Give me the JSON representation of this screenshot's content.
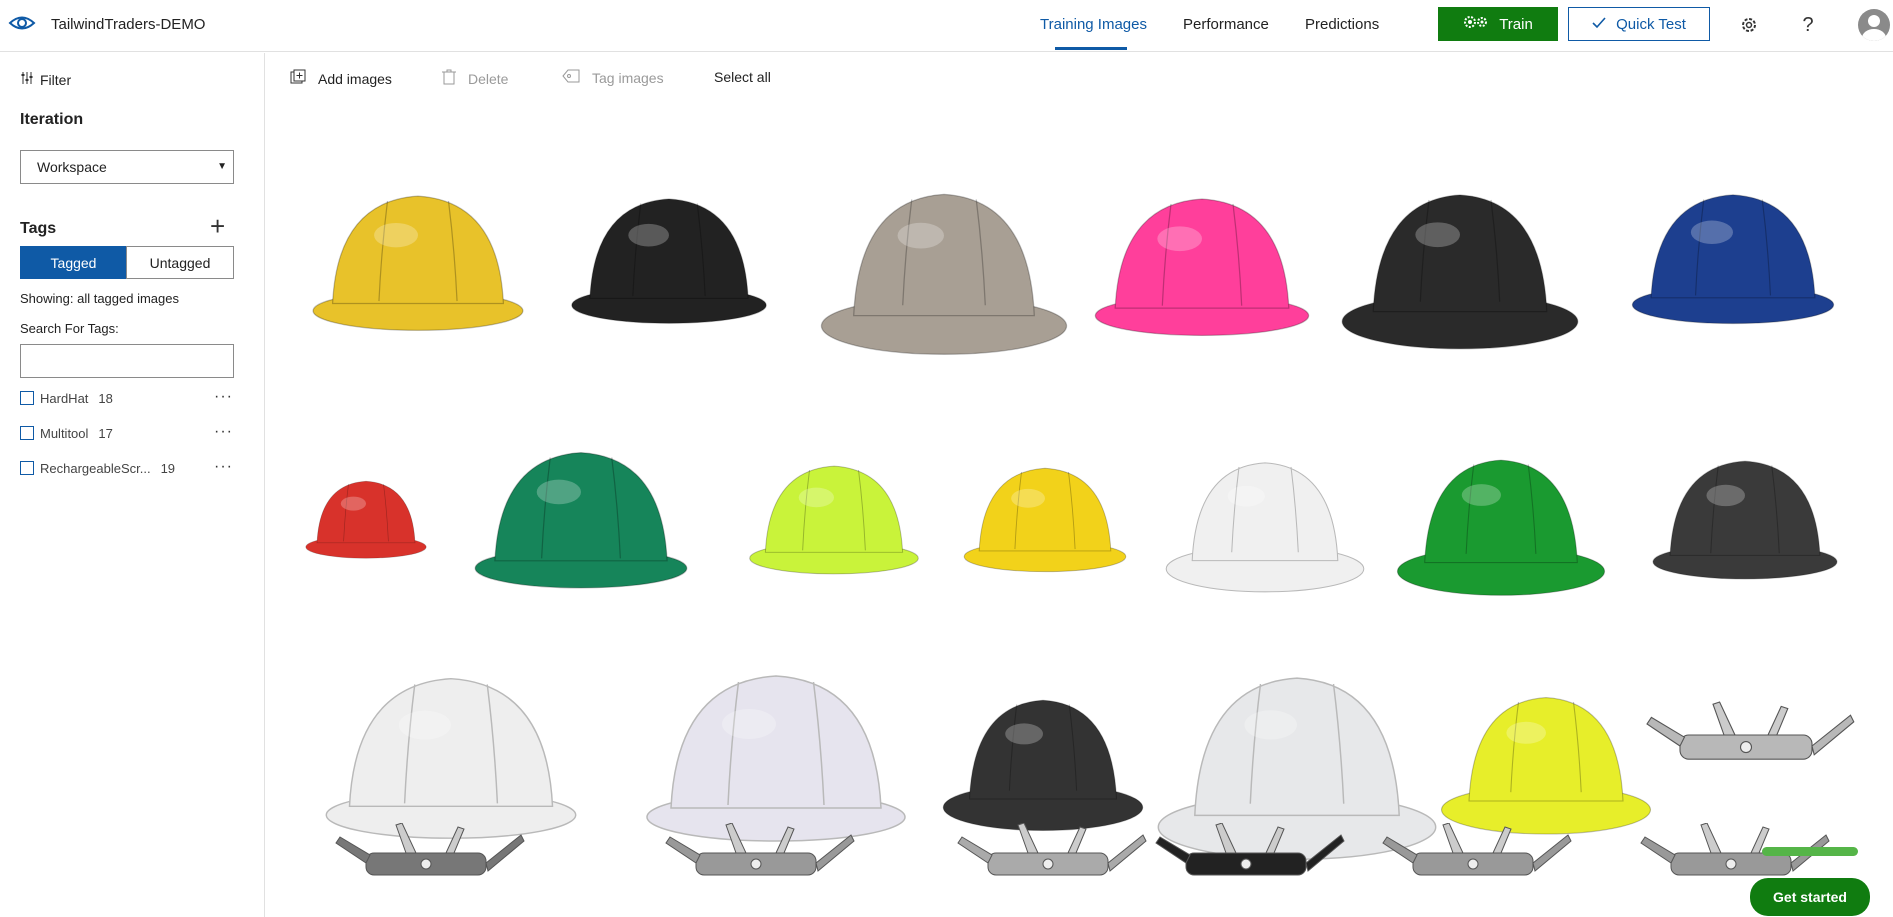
{
  "app": {
    "title": "TailwindTraders-DEMO"
  },
  "nav": {
    "tabs": [
      {
        "label": "Training Images",
        "active": true
      },
      {
        "label": "Performance",
        "active": false
      },
      {
        "label": "Predictions",
        "active": false
      }
    ],
    "train_label": "Train",
    "quick_test_label": "Quick Test"
  },
  "sidebar": {
    "filter_label": "Filter",
    "iteration_label": "Iteration",
    "iteration_value": "Workspace",
    "tags_label": "Tags",
    "tagged_label": "Tagged",
    "untagged_label": "Untagged",
    "showing_text": "Showing: all tagged images",
    "search_label": "Search For Tags:",
    "search_value": "",
    "tags": [
      {
        "name": "HardHat",
        "count": "18"
      },
      {
        "name": "Multitool",
        "count": "17"
      },
      {
        "name": "RechargeableScr...",
        "count": "19"
      }
    ]
  },
  "toolbar": {
    "add_images": "Add images",
    "delete": "Delete",
    "tag_images": "Tag images",
    "select_all": "Select all"
  },
  "gallery": {
    "images": [
      {
        "subject": "hardhat",
        "color": "#e8c22a"
      },
      {
        "subject": "hardhat",
        "color": "#222222"
      },
      {
        "subject": "hardhat",
        "color": "#a89f94"
      },
      {
        "subject": "hardhat",
        "color": "#ff3f9b"
      },
      {
        "subject": "hardhat",
        "color": "#2a2a2a"
      },
      {
        "subject": "hardhat",
        "color": "#1d3f8f"
      },
      {
        "subject": "hardhat",
        "color": "#d8322b"
      },
      {
        "subject": "hardhat",
        "color": "#16855a"
      },
      {
        "subject": "hardhat",
        "color": "#c9f33a"
      },
      {
        "subject": "hardhat",
        "color": "#f2d21a"
      },
      {
        "subject": "hardhat",
        "color": "#f0f0f0"
      },
      {
        "subject": "hardhat",
        "color": "#1a9a30"
      },
      {
        "subject": "hardhat",
        "color": "#3a3a3a"
      },
      {
        "subject": "hardhat",
        "color": "#eeeeee"
      },
      {
        "subject": "hardhat",
        "color": "#e6e4ee"
      },
      {
        "subject": "hardhat",
        "color": "#333333"
      },
      {
        "subject": "hardhat",
        "color": "#e7e8ea"
      },
      {
        "subject": "hardhat",
        "color": "#e7ee2a"
      },
      {
        "subject": "multitool",
        "color": "#b8b8b8"
      },
      {
        "subject": "multitool",
        "color": "#777777"
      },
      {
        "subject": "multitool",
        "color": "#999999"
      },
      {
        "subject": "multitool",
        "color": "#aaaaaa"
      },
      {
        "subject": "multitool",
        "color": "#222222"
      },
      {
        "subject": "multitool",
        "color": "#999999"
      },
      {
        "subject": "multitool",
        "color": "#999999"
      }
    ]
  },
  "get_started_label": "Get started",
  "colors": {
    "accent": "#0f5aa6",
    "train_green": "#107c10",
    "progress_green": "#55b548"
  }
}
